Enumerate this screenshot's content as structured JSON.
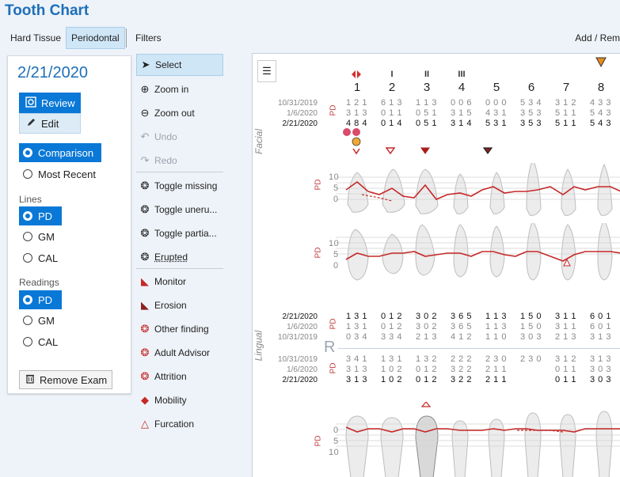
{
  "app": {
    "title": "Tooth Chart"
  },
  "tabs": [
    {
      "label": "Hard Tissue"
    },
    {
      "label": "Periodontal"
    },
    {
      "label": "Filters"
    }
  ],
  "add_remove_label": "Add / Rem",
  "panel": {
    "date": "2/21/2020",
    "review_label": "Review",
    "edit_label": "Edit",
    "mode_options": [
      "Comparison",
      "Most Recent"
    ],
    "lines_label": "Lines",
    "lines_options": [
      "PD",
      "GM",
      "CAL"
    ],
    "readings_label": "Readings",
    "readings_options": [
      "PD",
      "GM",
      "CAL"
    ],
    "remove_label": "Remove Exam"
  },
  "tools": [
    {
      "label": "Select",
      "icon": "cursor-icon"
    },
    {
      "label": "Zoom in",
      "icon": "zoom-in-icon"
    },
    {
      "label": "Zoom out",
      "icon": "zoom-out-icon"
    },
    {
      "label": "Undo",
      "icon": "undo-icon"
    },
    {
      "label": "Redo",
      "icon": "redo-icon"
    },
    {
      "label": "Toggle missing",
      "icon": "tooth-missing-icon"
    },
    {
      "label": "Toggle uneru...",
      "icon": "tooth-unerupted-icon"
    },
    {
      "label": "Toggle partia...",
      "icon": "tooth-partial-icon"
    },
    {
      "label": "Erupted",
      "icon": "tooth-erupted-icon"
    },
    {
      "label": "Monitor",
      "icon": "monitor-flag-icon"
    },
    {
      "label": "Erosion",
      "icon": "erosion-flag-icon"
    },
    {
      "label": "Other finding",
      "icon": "tooth-other-icon"
    },
    {
      "label": "Adult Advisor",
      "icon": "tooth-advisor-icon"
    },
    {
      "label": "Attrition",
      "icon": "tooth-attrition-icon"
    },
    {
      "label": "Mobility",
      "icon": "mobility-icon"
    },
    {
      "label": "Furcation",
      "icon": "furcation-icon"
    }
  ],
  "chart": {
    "tooth_numbers": [
      "1",
      "2",
      "3",
      "4",
      "5",
      "6",
      "7",
      "8"
    ],
    "furcation_marks": [
      "I",
      "II",
      "III"
    ],
    "facial_label": "Facial",
    "lingual_label": "Lingual",
    "pd_label": "PD",
    "r_label": "R",
    "facial_dates": [
      "10/31/2019",
      "1/6/2020",
      "2/21/2020"
    ],
    "facial_rows": [
      [
        "1 2 1",
        "6 1 3",
        "1 1 3",
        "0 0 6",
        "0 0 0",
        "5 3 4",
        "3 1 2",
        "4 3 3"
      ],
      [
        "3 1 3",
        "0 1 1",
        "0 5 1",
        "3 1 5",
        "4 3 1",
        "3 5 3",
        "5 1 1",
        "5 4 3"
      ],
      [
        "4 8 4",
        "0 1 4",
        "0 5 1",
        "3 1 4",
        "5 3 1",
        "3 5 3",
        "5 1 1",
        "5 4 3"
      ]
    ],
    "lingual_upper_dates": [
      "2/21/2020",
      "1/6/2020",
      "10/31/2019"
    ],
    "lingual_upper_rows": [
      [
        "1 3 1",
        "0 1 2",
        "3 0 2",
        "3 6 5",
        "1 1 3",
        "1 5 0",
        "3 1 1",
        "6 0 1"
      ],
      [
        "1 3 1",
        "0 1 2",
        "3 0 2",
        "3 6 5",
        "1 1 3",
        "1 5 0",
        "3 1 1",
        "6 0 1"
      ],
      [
        "0 3 4",
        "3 3 4",
        "2 1 3",
        "4 1 2",
        "1 1 0",
        "3 0 3",
        "2 1 3",
        "3 1 3"
      ]
    ],
    "lingual_lower_dates": [
      "10/31/2019",
      "1/6/2020",
      "2/21/2020"
    ],
    "lingual_lower_rows": [
      [
        "3 4 1",
        "1 3 1",
        "1 3 2",
        "2 2 2",
        "2 3 0",
        "2 3 0",
        "3 1 2",
        "3 1 3"
      ],
      [
        "3 1 3",
        "1 0 2",
        "0 1 2",
        "3 2 2",
        "2 1 1",
        "",
        "0 1 1",
        "3 0 3"
      ],
      [
        "3 1 3",
        "1 0 2",
        "0 1 2",
        "3 2 2",
        "2 1 1",
        "",
        "0 1 1",
        "3 0 3"
      ]
    ],
    "axis_ticks_upper": [
      "10",
      "5",
      "0"
    ],
    "axis_ticks_lower": [
      "0",
      "5",
      "10"
    ]
  }
}
